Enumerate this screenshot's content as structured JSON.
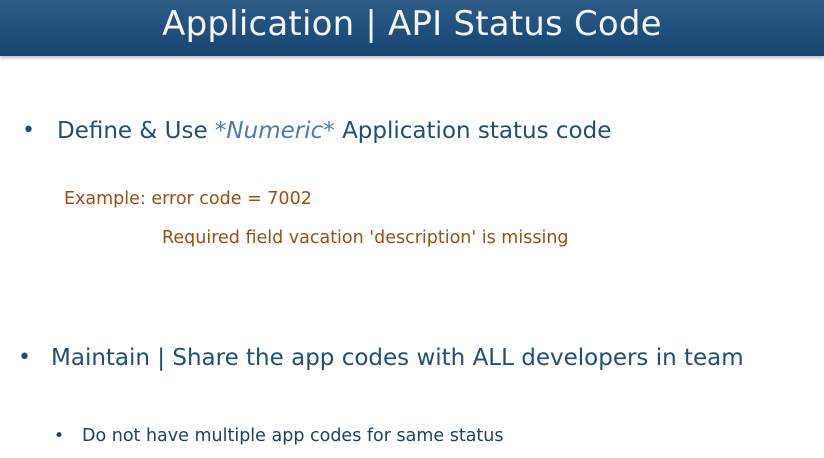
{
  "title": "Application | API  Status Code",
  "bullets": [
    {
      "glyph": "•",
      "prefix": "Define & Use ",
      "emphasis": "*Numeric*",
      "suffix": " Application status code"
    },
    {
      "glyph": "•",
      "text": "Maintain | Share the app codes with ALL developers in team"
    }
  ],
  "example": {
    "line1": "Example:  error code = 7002",
    "line2": "Required field vacation 'description' is missing"
  },
  "sub_bullets": [
    {
      "glyph": "•",
      "text": "Do not have multiple app codes for same status"
    }
  ],
  "colors": {
    "title_bar": "#1f4f7c",
    "bullet_text": "#1f4e79",
    "emphasis": "#4a78c2",
    "example_text": "#9c4f13"
  }
}
